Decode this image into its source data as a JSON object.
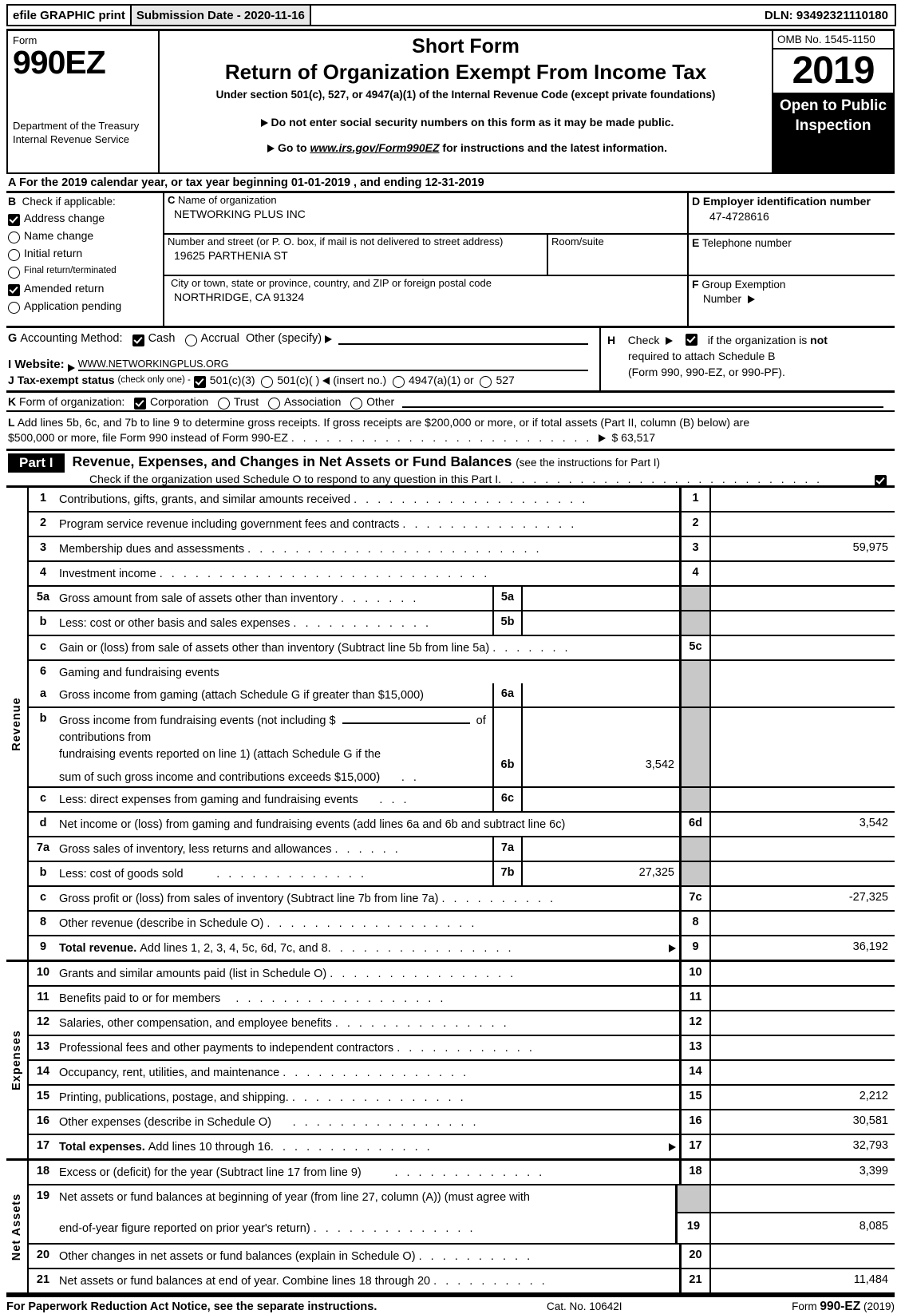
{
  "efile": {
    "graphic_print": "efile GRAPHIC print",
    "submission_date": "Submission Date - 2020-11-16",
    "dln": "DLN: 93492321110180"
  },
  "masthead": {
    "form_word": "Form",
    "form_number": "990EZ",
    "department": "Department of the Treasury Internal Revenue Service",
    "title_line1": "Short Form",
    "title_line2": "Return of Organization Exempt From Income Tax",
    "subtitle": "Under section 501(c), 527, or 4947(a)(1) of the Internal Revenue Code (except private foundations)",
    "note1": "Do not enter social security numbers on this form as it may be made public.",
    "note2_prefix": "Go to",
    "note2_url": "www.irs.gov/Form990EZ",
    "note2_suffix": "for instructions and the latest information.",
    "omb": "OMB No. 1545-1150",
    "year": "2019",
    "open_to_public": "Open to Public Inspection"
  },
  "lineA": {
    "letter": "A",
    "text": "For the 2019 calendar year, or tax year beginning 01-01-2019 , and ending 12-31-2019"
  },
  "sectionB": {
    "letter": "B",
    "heading": "Check if applicable:",
    "items": [
      {
        "label": "Address change",
        "checked": true
      },
      {
        "label": "Name change",
        "checked": false
      },
      {
        "label": "Initial return",
        "checked": false
      },
      {
        "label": "Final return/terminated",
        "checked": false
      },
      {
        "label": "Amended return",
        "checked": true
      },
      {
        "label": "Application pending",
        "checked": false
      }
    ]
  },
  "sectionC": {
    "letter": "C",
    "name_label": "Name of organization",
    "name_value": "NETWORKING PLUS INC",
    "street_label": "Number and street (or P. O. box, if mail is not delivered to street address)",
    "street_value": "19625 PARTHENIA ST",
    "room_label": "Room/suite",
    "room_value": "",
    "city_label": "City or town, state or province, country, and ZIP or foreign postal code",
    "city_value": "NORTHRIDGE, CA  91324"
  },
  "sectionD": {
    "letter": "D",
    "label": "Employer identification number",
    "value": "47-4728616"
  },
  "sectionE": {
    "letter": "E",
    "label": "Telephone number",
    "value": ""
  },
  "sectionF": {
    "letter": "F",
    "label_line1": "Group Exemption",
    "label_line2": "Number",
    "value": ""
  },
  "sectionG": {
    "letter": "G",
    "label": "Accounting Method:",
    "cash": "Cash",
    "cash_checked": true,
    "accrual": "Accrual",
    "accrual_checked": false,
    "other": "Other (specify)",
    "other_value": ""
  },
  "sectionH": {
    "letter": "H",
    "check_label": "Check",
    "checked": true,
    "text_a": "if the organization is",
    "text_not": "not",
    "text_b": "required to attach Schedule B",
    "text_c": "(Form 990, 990-EZ, or 990-PF)."
  },
  "sectionI": {
    "letter": "I",
    "label": "Website:",
    "value": "WWW.NETWORKINGPLUS.ORG"
  },
  "sectionJ": {
    "letter": "J",
    "label": "Tax-exempt status",
    "note": "(check only one) -",
    "opt1": "501(c)(3)",
    "opt1_checked": true,
    "opt2": "501(c)(    )",
    "opt2_checked": false,
    "insert": "(insert no.)",
    "opt3": "4947(a)(1) or",
    "opt3_checked": false,
    "opt4": "527",
    "opt4_checked": false
  },
  "sectionK": {
    "letter": "K",
    "label": "Form of organization:",
    "options": [
      {
        "label": "Corporation",
        "checked": true
      },
      {
        "label": "Trust",
        "checked": false
      },
      {
        "label": "Association",
        "checked": false
      },
      {
        "label": "Other",
        "checked": false
      }
    ]
  },
  "sectionL": {
    "letter": "L",
    "text_line1": "Add lines 5b, 6c, and 7b to line 9 to determine gross receipts. If gross receipts are $200,000 or more, or if total assets (Part II, column (B) below) are",
    "text_line2": "$500,000 or more, file Form 990 instead of Form 990-EZ",
    "amount": "$ 63,517"
  },
  "partI": {
    "badge": "Part I",
    "title": "Revenue, Expenses, and Changes in Net Assets or Fund Balances",
    "title_note": "(see the instructions for Part I)",
    "schedule_o_text": "Check if the organization used Schedule O to respond to any question in this Part I",
    "schedule_o_checked": true
  },
  "revenue": {
    "side_label": "Revenue",
    "rows": [
      {
        "num": "1",
        "text": "Contributions, gifts, grants, and similar amounts received",
        "dots": 20,
        "id": "1",
        "amount": ""
      },
      {
        "num": "2",
        "text": "Program service revenue including government fees and contracts",
        "dots": 15,
        "id": "2",
        "amount": ""
      },
      {
        "num": "3",
        "text": "Membership dues and assessments",
        "dots": 25,
        "id": "3",
        "amount": "59,975"
      },
      {
        "num": "4",
        "text": "Investment income",
        "dots": 28,
        "id": "4",
        "amount": ""
      },
      {
        "num": "5a",
        "text": "Gross amount from sale of assets other than inventory",
        "dots": 8,
        "inner_id": "5a",
        "inner_amount": "",
        "shade": true
      },
      {
        "num": "b",
        "text": "Less: cost or other basis and sales expenses",
        "dots": 12,
        "inner_id": "5b",
        "inner_amount": "",
        "shade": true
      },
      {
        "num": "c",
        "text": "Gain or (loss) from sale of assets other than inventory (Subtract line 5b from line 5a)",
        "dots": 7,
        "id": "5c",
        "amount": ""
      },
      {
        "num": "6",
        "text": "Gaming and fundraising events",
        "dots": 0,
        "shade": true
      },
      {
        "num": "a",
        "text": "Gross income from gaming (attach Schedule G if greater than $15,000)",
        "dots": 0,
        "inner_id": "6a",
        "inner_amount": "",
        "shade": true
      },
      {
        "num": "b",
        "text": "Gross income from fundraising events (not including $",
        "text2": "of contributions from",
        "text3": "fundraising events reported on line 1) (attach Schedule G if the",
        "text4": "sum of such gross income and contributions exceeds $15,000)",
        "dots": 2,
        "inner_id": "6b",
        "inner_amount": "3,542",
        "shade": true
      },
      {
        "num": "c",
        "text": "Less: direct expenses from gaming and fundraising events",
        "dots": 3,
        "inner_id": "6c",
        "inner_amount": "",
        "shade": true
      },
      {
        "num": "d",
        "text": "Net income or (loss) from gaming and fundraising events (add lines 6a and 6b and subtract line 6c)",
        "dots": 0,
        "id": "6d",
        "amount": "3,542"
      },
      {
        "num": "7a",
        "text": "Gross sales of inventory, less returns and allowances",
        "dots": 6,
        "inner_id": "7a",
        "inner_amount": "",
        "shade": true
      },
      {
        "num": "b",
        "text": "Less: cost of goods sold",
        "dots": 14,
        "inner_id": "7b",
        "inner_amount": "27,325",
        "shade": true
      },
      {
        "num": "c",
        "text": "Gross profit or (loss) from sales of inventory (Subtract line 7b from line 7a)",
        "dots": 10,
        "id": "7c",
        "amount": "-27,325"
      },
      {
        "num": "8",
        "text": "Other revenue (describe in Schedule O)",
        "dots": 18,
        "id": "8",
        "amount": ""
      },
      {
        "num": "9",
        "text_bold": "Total revenue.",
        "text": "Add lines 1, 2, 3, 4, 5c, 6d, 7c, and 8",
        "dots": 16,
        "arrow": true,
        "id": "9",
        "amount": "36,192"
      }
    ]
  },
  "expenses": {
    "side_label": "Expenses",
    "rows": [
      {
        "num": "10",
        "text": "Grants and similar amounts paid (list in Schedule O)",
        "dots": 16,
        "id": "10",
        "amount": ""
      },
      {
        "num": "11",
        "text": "Benefits paid to or for members",
        "dots": 18,
        "id": "11",
        "amount": ""
      },
      {
        "num": "12",
        "text": "Salaries, other compensation, and employee benefits",
        "dots": 15,
        "id": "12",
        "amount": ""
      },
      {
        "num": "13",
        "text": "Professional fees and other payments to independent contractors",
        "dots": 12,
        "id": "13",
        "amount": ""
      },
      {
        "num": "14",
        "text": "Occupancy, rent, utilities, and maintenance",
        "dots": 16,
        "id": "14",
        "amount": ""
      },
      {
        "num": "15",
        "text": "Printing, publications, postage, and shipping.",
        "dots": 15,
        "id": "15",
        "amount": "2,212"
      },
      {
        "num": "16",
        "text": "Other expenses (describe in Schedule O)",
        "dots": 16,
        "id": "16",
        "amount": "30,581"
      },
      {
        "num": "17",
        "text_bold": "Total expenses.",
        "text": "Add lines 10 through 16",
        "dots": 14,
        "arrow": true,
        "id": "17",
        "amount": "32,793"
      }
    ]
  },
  "netassets": {
    "side_label": "Net Assets",
    "rows": [
      {
        "num": "18",
        "text": "Excess or (deficit) for the year (Subtract line 17 from line 9)",
        "dots": 13,
        "id": "18",
        "amount": "3,399"
      },
      {
        "num": "19",
        "text": "Net assets or fund balances at beginning of year (from line 27, column (A)) (must agree with",
        "text2": "end-of-year figure reported on prior year's return)",
        "dots": 14,
        "id": "19",
        "amount": "8,085"
      },
      {
        "num": "20",
        "text": "Other changes in net assets or fund balances (explain in Schedule O)",
        "dots": 10,
        "id": "20",
        "amount": ""
      },
      {
        "num": "21",
        "text": "Net assets or fund balances at end of year. Combine lines 18 through 20",
        "dots": 10,
        "id": "21",
        "amount": "11,484"
      }
    ]
  },
  "footer": {
    "left": "For Paperwork Reduction Act Notice, see the separate instructions.",
    "center": "Cat. No. 10642I",
    "right_prefix": "Form",
    "right_bold": "990-EZ",
    "right_suffix": "(2019)"
  }
}
